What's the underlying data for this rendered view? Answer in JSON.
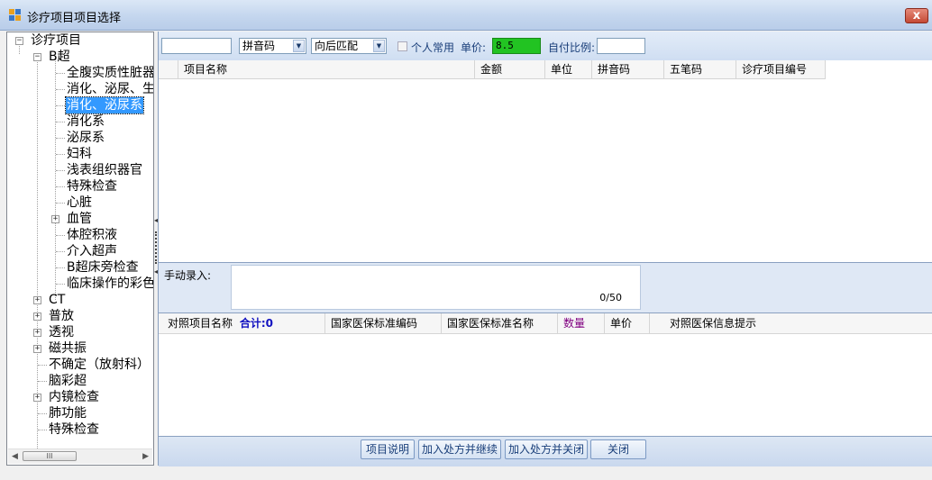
{
  "window": {
    "title": "诊疗项目项目选择",
    "close_label": "x"
  },
  "tree": {
    "items": [
      {
        "label": "诊疗项目"
      },
      {
        "label": "B超"
      },
      {
        "label": "全腹实质性脏器"
      },
      {
        "label": "消化、泌尿、生"
      },
      {
        "label": "消化、泌尿系"
      },
      {
        "label": "消化系"
      },
      {
        "label": "泌尿系"
      },
      {
        "label": "妇科"
      },
      {
        "label": "浅表组织器官"
      },
      {
        "label": "特殊检查"
      },
      {
        "label": "心脏"
      },
      {
        "label": "血管"
      },
      {
        "label": "体腔积液"
      },
      {
        "label": "介入超声"
      },
      {
        "label": "B超床旁检查"
      },
      {
        "label": "临床操作的彩色"
      },
      {
        "label": "CT"
      },
      {
        "label": "普放"
      },
      {
        "label": "透视"
      },
      {
        "label": "磁共振"
      },
      {
        "label": "不确定（放射科）"
      },
      {
        "label": "脑彩超"
      },
      {
        "label": "内镜检查"
      },
      {
        "label": "肺功能"
      },
      {
        "label": "特殊检查"
      }
    ],
    "collapse_glyph": "−",
    "expand_glyph": "+",
    "scroll_thumb": "III"
  },
  "toolbar": {
    "search_value": "",
    "match_type": "拼音码",
    "match_mode": "向后匹配",
    "personal_common_label": "个人常用",
    "price_label": "单价:",
    "price_value": "8.5",
    "self_pay_label": "自付比例:",
    "self_pay_value": ""
  },
  "grid1": {
    "columns": [
      "项目名称",
      "金额",
      "单位",
      "拼音码",
      "五笔码",
      "诊疗项目编号"
    ]
  },
  "manual": {
    "label": "手动录入:",
    "value": "",
    "counter": "0/50"
  },
  "grid2": {
    "col_name": "对照项目名称",
    "total_label": "合计:0",
    "columns": [
      "国家医保标准编码",
      "国家医保标准名称",
      "数量",
      "单价",
      "对照医保信息提示"
    ]
  },
  "buttons": {
    "description": "项目说明",
    "add_continue": "加入处方并继续",
    "add_close": "加入处方并关闭",
    "close": "关闭"
  },
  "colors": {
    "price_bg": "#22c322",
    "selection": "#3399ff",
    "qty_header": "#800080",
    "total": "#1010c0"
  }
}
